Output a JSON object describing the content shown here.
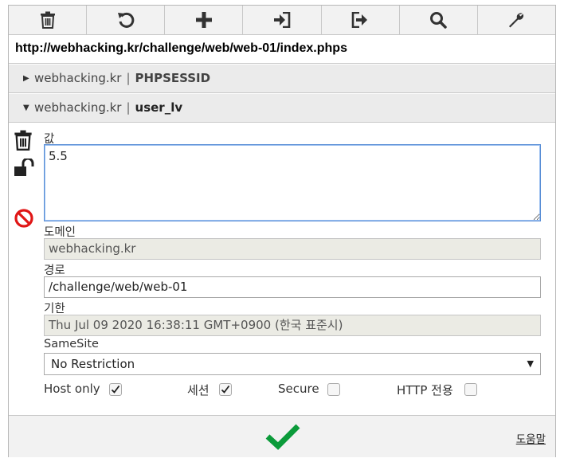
{
  "toolbar": {
    "icons": [
      "trash-icon",
      "undo-icon",
      "plus-icon",
      "import-icon",
      "export-icon",
      "search-icon",
      "wrench-icon"
    ]
  },
  "url": "http://webhacking.kr/challenge/web/web-01/index.phps",
  "cookies": [
    {
      "domain": "webhacking.kr",
      "separator": "|",
      "name": "PHPSESSID",
      "expanded": false
    },
    {
      "domain": "webhacking.kr",
      "separator": "|",
      "name": "user_lv",
      "expanded": true
    }
  ],
  "editor": {
    "value_label": "값",
    "value": "5.5",
    "domain_label": "도메인",
    "domain": "webhacking.kr",
    "path_label": "경로",
    "path": "/challenge/web/web-01",
    "expires_label": "기한",
    "expires": "Thu Jul 09 2020 16:38:11 GMT+0900 (한국 표준시)",
    "samesite_label": "SameSite",
    "samesite": "No Restriction",
    "host_only_label": "Host only",
    "host_only": true,
    "session_label": "세션",
    "session": true,
    "secure_label": "Secure",
    "secure": false,
    "http_only_label": "HTTP 전용",
    "http_only": false
  },
  "footer": {
    "save_icon": "checkmark-icon",
    "help_label": "도움말"
  },
  "colors": {
    "accent_green": "#0b9b3a",
    "block_red": "#e01616",
    "focus_blue": "#5a8fd6"
  }
}
